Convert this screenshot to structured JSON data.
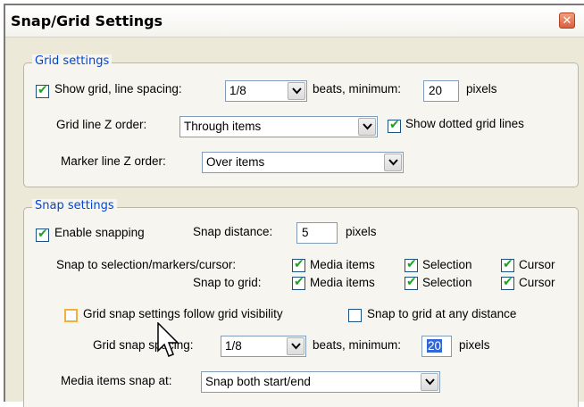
{
  "window": {
    "title": "Snap/Grid Settings",
    "close_icon": "close-icon",
    "close_glyph": "✕"
  },
  "grid": {
    "group_title": "Grid settings",
    "show_grid_label": "Show grid, line spacing:",
    "show_grid_checked": true,
    "spacing_value": "1/8",
    "beats_min_label": "beats, minimum:",
    "min_value": "20",
    "pixels_label": "pixels",
    "z_order_label": "Grid line Z order:",
    "z_order_value": "Through items",
    "dotted_label": "Show dotted grid lines",
    "dotted_checked": true,
    "marker_z_label": "Marker line  Z order:",
    "marker_z_value": "Over items"
  },
  "snap": {
    "group_title": "Snap settings",
    "enable_label": "Enable snapping",
    "enable_checked": true,
    "distance_label": "Snap distance:",
    "distance_value": "5",
    "distance_unit": "pixels",
    "snap_to_sel_label": "Snap to selection/markers/cursor:",
    "snap_to_grid_label": "Snap to grid:",
    "media_items_label": "Media items",
    "selection_label": "Selection",
    "cursor_label": "Cursor",
    "follow_vis_label": "Grid snap settings follow grid visibility",
    "follow_vis_checked": false,
    "any_distance_label": "Snap to grid at any distance",
    "any_distance_checked": false,
    "grid_spacing_label": "Grid snap spacing:",
    "grid_spacing_value": "1/8",
    "beats_min_label": "beats, minimum:",
    "min_value": "20",
    "pixels_label": "pixels",
    "media_snap_label": "Media items snap at:",
    "media_snap_value": "Snap both start/end"
  }
}
